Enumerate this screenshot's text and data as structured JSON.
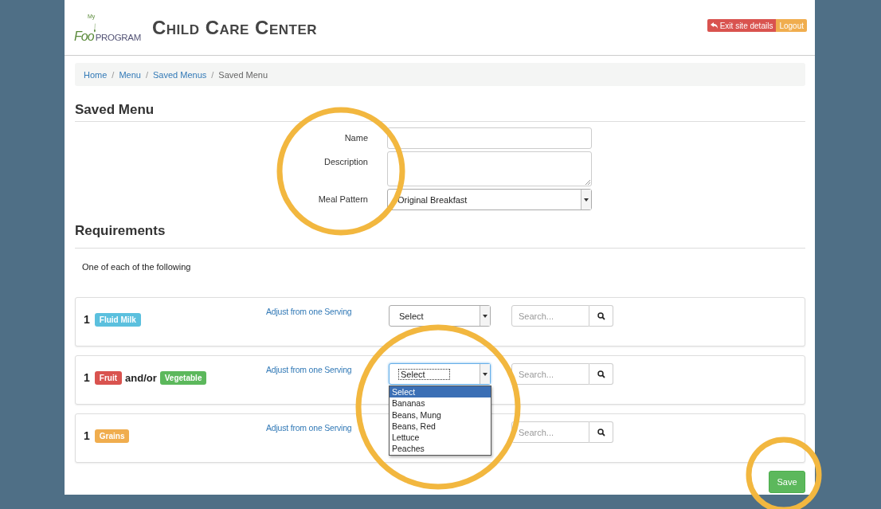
{
  "header": {
    "logo": {
      "small": "My",
      "left": "Foo",
      "right": "PROGRAM"
    },
    "title": "Child Care Center",
    "buttons": [
      {
        "kind": "exit",
        "label": "Exit site details"
      },
      {
        "kind": "logout",
        "label": "Logout"
      }
    ]
  },
  "breadcrumb": [
    {
      "label": "Home",
      "current": false
    },
    {
      "separator": "/",
      "label": "Menu",
      "current": false
    },
    {
      "separator": "/",
      "label": "Saved Menus",
      "current": false
    },
    {
      "separator": "/",
      "label": "Saved Menu",
      "current": true
    }
  ],
  "heading": "Saved Menu",
  "form": [
    {
      "kind": "input",
      "label": "Name"
    },
    {
      "kind": "textarea",
      "label": "Description"
    },
    {
      "kind": "select",
      "label": "Meal Pattern",
      "value": "Original Breakfast"
    }
  ],
  "requirements_heading": "Requirements",
  "intro": "One of each of the following",
  "requirements": [
    {
      "count": "1",
      "parts": [
        {
          "kind": "badge",
          "text": "Fluid Milk",
          "color": "#5bc0de"
        }
      ],
      "link": "Adjust from one Serving",
      "select": {
        "value": "Select",
        "open": false
      },
      "search": {
        "placeholder": "Search..."
      }
    },
    {
      "count": "1",
      "parts": [
        {
          "kind": "badge",
          "text": "Fruit",
          "color": "#d9534f"
        },
        {
          "kind": "text",
          "text": "and/or"
        },
        {
          "kind": "badge",
          "text": "Vegetable",
          "color": "#5cb85c"
        }
      ],
      "link": "Adjust from one Serving",
      "select": {
        "value": "Select",
        "open": true,
        "options": [
          {
            "label": "Select",
            "selected": true
          },
          {
            "label": "Bananas",
            "selected": false
          },
          {
            "label": "Beans, Mung",
            "selected": false
          },
          {
            "label": "Beans, Red",
            "selected": false
          },
          {
            "label": "Lettuce",
            "selected": false
          },
          {
            "label": "Peaches",
            "selected": false
          }
        ]
      },
      "search": {
        "placeholder": "Search..."
      }
    },
    {
      "count": "1",
      "parts": [
        {
          "kind": "badge",
          "text": "Grains",
          "color": "#f0ad4e"
        }
      ],
      "link": "Adjust from one Serving",
      "search": {
        "placeholder": "Search..."
      }
    }
  ],
  "save_button": "Save"
}
